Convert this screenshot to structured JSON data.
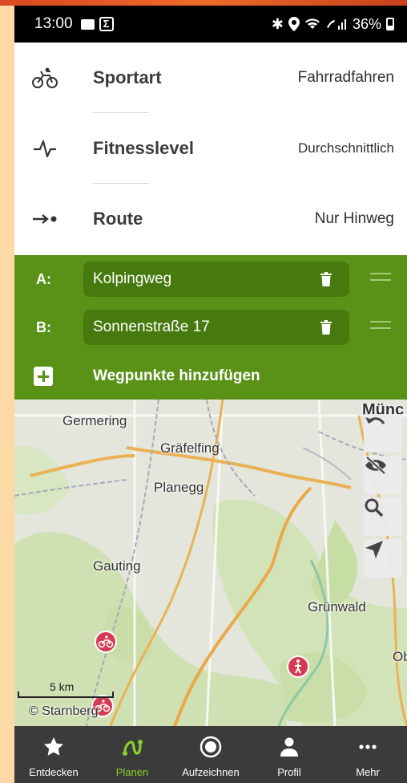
{
  "status_bar": {
    "time": "13:00",
    "battery": "36%"
  },
  "settings": {
    "sport_label": "Sportart",
    "sport_value": "Fahrradfahren",
    "fitness_label": "Fitnesslevel",
    "fitness_value": "Durchschnittlich",
    "route_label": "Route",
    "route_value": "Nur Hinweg"
  },
  "waypoints": [
    {
      "key": "A:",
      "value": "Kolpingweg"
    },
    {
      "key": "B:",
      "value": "Sonnenstraße 17"
    }
  ],
  "add_waypoint_label": "Wegpunkte hinzufügen",
  "map": {
    "labels": {
      "germering": "Germering",
      "graefelfing": "Gräfelfing",
      "planegg": "Planegg",
      "gauting": "Gauting",
      "gruenwald": "Grünwald",
      "muenchen": "Münc",
      "ob": "Ob",
      "starnberg": "© Starnberg"
    },
    "scale": "5 km"
  },
  "nav": [
    {
      "label": "Entdecken",
      "icon": "star-icon"
    },
    {
      "label": "Planen",
      "icon": "route-icon"
    },
    {
      "label": "Aufzeichnen",
      "icon": "record-icon"
    },
    {
      "label": "Profil",
      "icon": "person-icon"
    },
    {
      "label": "Mehr",
      "icon": "more-icon"
    }
  ],
  "colors": {
    "accent_green": "#5a9117",
    "active_nav": "#8ccd2c",
    "poi_red": "#d43a51"
  }
}
